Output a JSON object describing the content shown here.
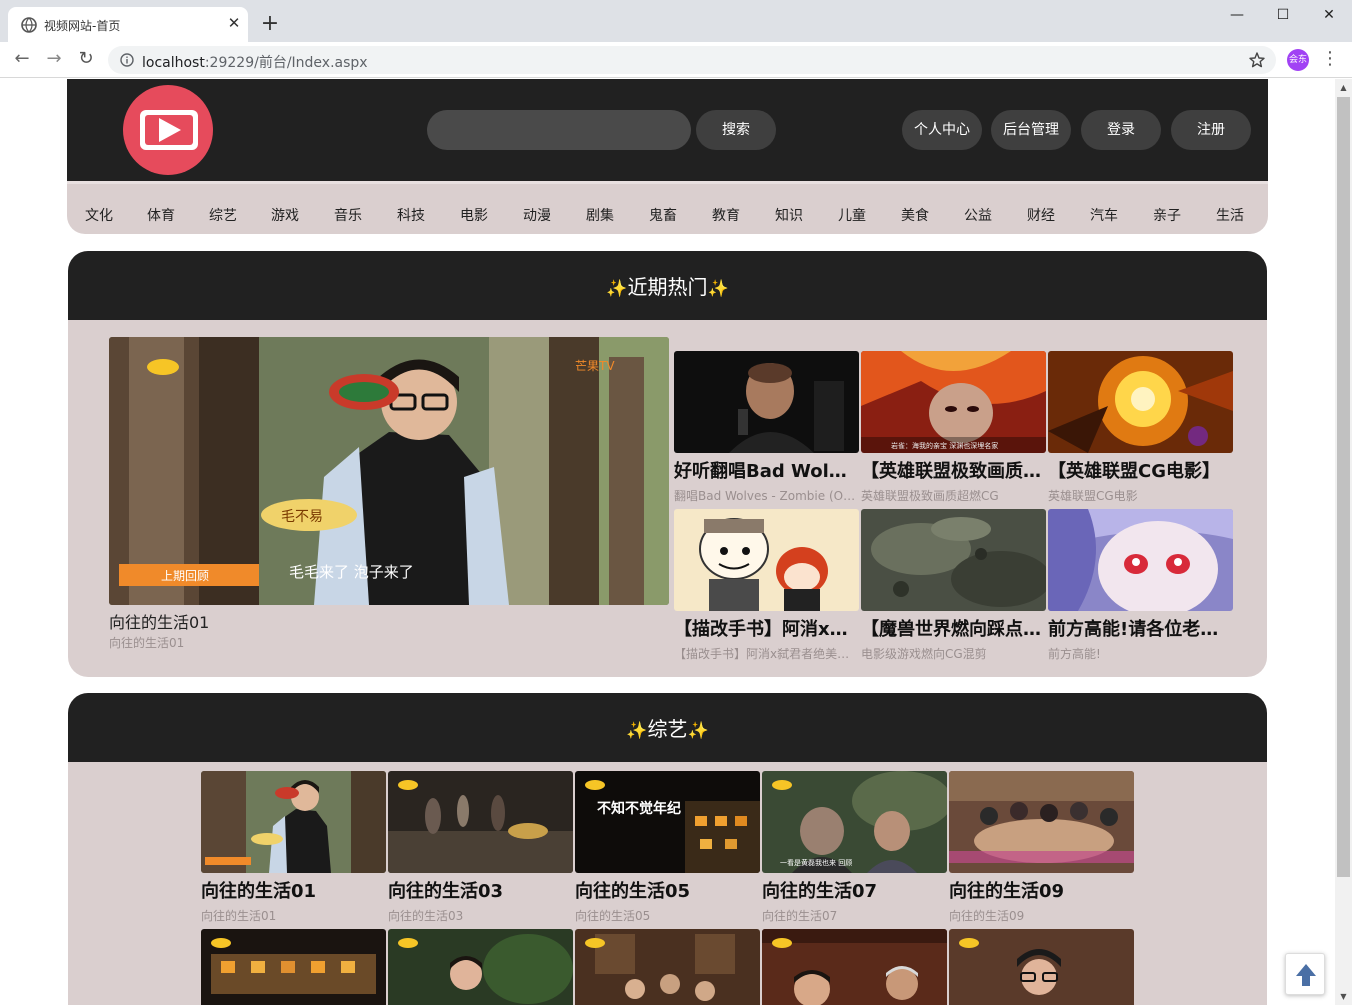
{
  "browser": {
    "tab_title": "视频网站-首页",
    "url_host": "localhost",
    "url_path": ":29229/前台/Index.aspx",
    "profile_label": "会东"
  },
  "header": {
    "search_placeholder": "",
    "search_label": "搜索",
    "profile_label": "个人中心",
    "admin_label": "后台管理",
    "login_label": "登录",
    "register_label": "注册"
  },
  "categories": [
    "文化",
    "体育",
    "综艺",
    "游戏",
    "音乐",
    "科技",
    "电影",
    "动漫",
    "剧集",
    "鬼畜",
    "教育",
    "知识",
    "儿童",
    "美食",
    "公益",
    "财经",
    "汽车",
    "亲子",
    "生活"
  ],
  "hot": {
    "title": "近期热门",
    "featured": {
      "title": "向往的生活01",
      "subtitle": "向往的生活01"
    },
    "items": [
      {
        "title": "好听翻唱Bad Wolves - Zombie",
        "subtitle": "翻唱Bad Wolves - Zombie (Official Video)"
      },
      {
        "title": "【英雄联盟极致画质超燃CG】",
        "subtitle": "英雄联盟极致画质超燃CG"
      },
      {
        "title": "【英雄联盟CG电影】",
        "subtitle": "英雄联盟CG电影"
      },
      {
        "title": "【描改手书】阿消x弑君者绝美爱情",
        "subtitle": "【描改手书】阿消x弑君者绝美爱情故事"
      },
      {
        "title": "【魔兽世界燃向踩点混剪】",
        "subtitle": "电影级游戏燃向CG混剪"
      },
      {
        "title": "前方高能!请各位老司机注意",
        "subtitle": "前方高能!"
      }
    ]
  },
  "variety": {
    "title": "综艺",
    "items": [
      {
        "title": "向往的生活01",
        "subtitle": "向往的生活01"
      },
      {
        "title": "向往的生活03",
        "subtitle": "向往的生活03"
      },
      {
        "title": "向往的生活05",
        "subtitle": "向往的生活05"
      },
      {
        "title": "向往的生活07",
        "subtitle": "向往的生活07"
      },
      {
        "title": "向往的生活09",
        "subtitle": "向往的生活09"
      }
    ]
  },
  "thumb_overlays": {
    "feat_banner": "上期回顾",
    "feat_caption": "毛毛来了 泡子来了",
    "feat_badge": "毛不易",
    "feat_watermark": "芒果TV",
    "lol_caption": "岩雀：海我的亲宝 深渊也深埋名家",
    "v5_logo": "不知不觉年纪",
    "v7_caption": "一看是黄磊我也来 回顾"
  },
  "colors": {
    "header_bg": "#212121",
    "panel_bg": "#dacfcf",
    "logo_red": "#e64b5c",
    "pill_bg": "#3f3f3f"
  }
}
